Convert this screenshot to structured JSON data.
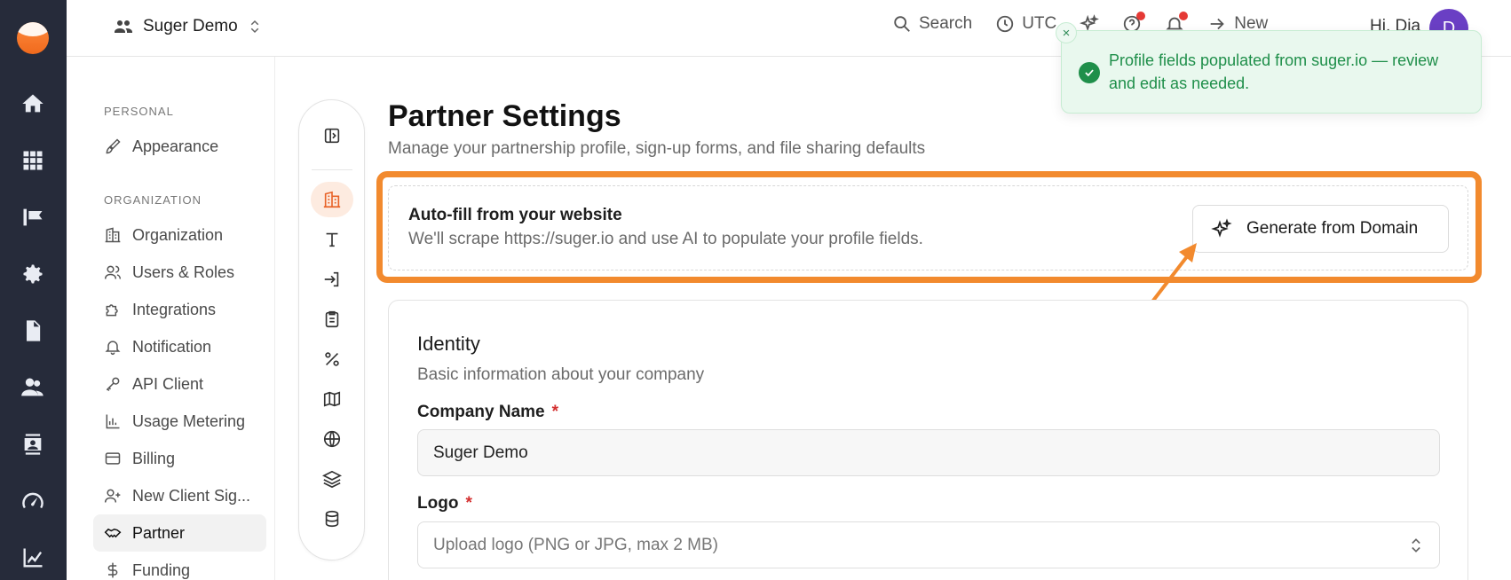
{
  "topbar": {
    "org_name": "Suger Demo",
    "search_label": "Search",
    "timezone_label": "UTC",
    "new_label": "New",
    "greeting": "Hi, Dia",
    "avatar_initial": "D"
  },
  "sidebar": {
    "section_personal": "PERSONAL",
    "section_organization": "ORGANIZATION",
    "items": [
      {
        "label": "Appearance"
      },
      {
        "label": "Organization"
      },
      {
        "label": "Users & Roles"
      },
      {
        "label": "Integrations"
      },
      {
        "label": "Notification"
      },
      {
        "label": "API Client"
      },
      {
        "label": "Usage Metering"
      },
      {
        "label": "Billing"
      },
      {
        "label": "New Client Sig..."
      },
      {
        "label": "Partner"
      },
      {
        "label": "Funding"
      }
    ],
    "active_item": "Partner"
  },
  "main": {
    "title": "Partner Settings",
    "subtitle": "Manage your partnership profile, sign-up forms, and file sharing defaults",
    "autofill": {
      "title": "Auto-fill from your website",
      "description": "We'll scrape https://suger.io and use AI to populate your profile fields.",
      "button_label": "Generate from Domain"
    },
    "identity": {
      "title": "Identity",
      "subtitle": "Basic information about your company",
      "company_name_label": "Company Name",
      "company_name_value": "Suger Demo",
      "logo_label": "Logo",
      "logo_placeholder": "Upload logo (PNG or JPG, max 2 MB)",
      "required_mark": "*"
    }
  },
  "toast": {
    "message": "Profile fields populated from suger.io — review and edit as needed.",
    "close_glyph": "×"
  },
  "colors": {
    "rail_bg": "#262b3a",
    "accent_orange": "#f28a2e",
    "success_green": "#1f8f4a",
    "avatar_purple": "#6a3fc4"
  }
}
